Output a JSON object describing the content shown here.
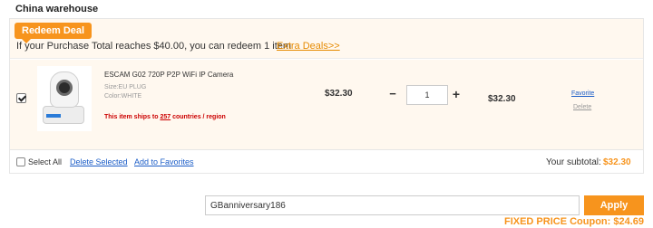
{
  "section_title": "China warehouse",
  "deal": {
    "badge": "Redeem Deal",
    "message": "If your Purchase Total reaches $40.00, you can redeem 1 item",
    "extra_link": "Extra Deals>>"
  },
  "item": {
    "checked": true,
    "name": "ESCAM G02 720P P2P WiFi IP Camera",
    "size": "Size:EU PLUG",
    "color": "Color:WHITE",
    "ship_prefix": "This item ships to ",
    "ship_count": "257",
    "ship_suffix": " countries / region",
    "price": "$32.30",
    "minus": "−",
    "quantity": "1",
    "plus": "+",
    "subtotal": "$32.30",
    "favorite_link": "Favorite",
    "delete_link": "Delete"
  },
  "footer": {
    "select_all": "Select All",
    "delete_selected": "Delete Selected",
    "add_to_favorites": "Add to Favorites",
    "subtotal_label": "Your subtotal:",
    "subtotal_value": "$32.30"
  },
  "coupon": {
    "value": "GBanniversary186",
    "apply_label": "Apply",
    "fixed_price_text": "FIXED PRICE Coupon: $24.69"
  },
  "colors": {
    "accent": "#f7941d",
    "link": "#1a5cc7",
    "alert": "#cc0000",
    "row_bg": "#fff8ef"
  },
  "icons": {
    "product_image": "camera-icon"
  }
}
